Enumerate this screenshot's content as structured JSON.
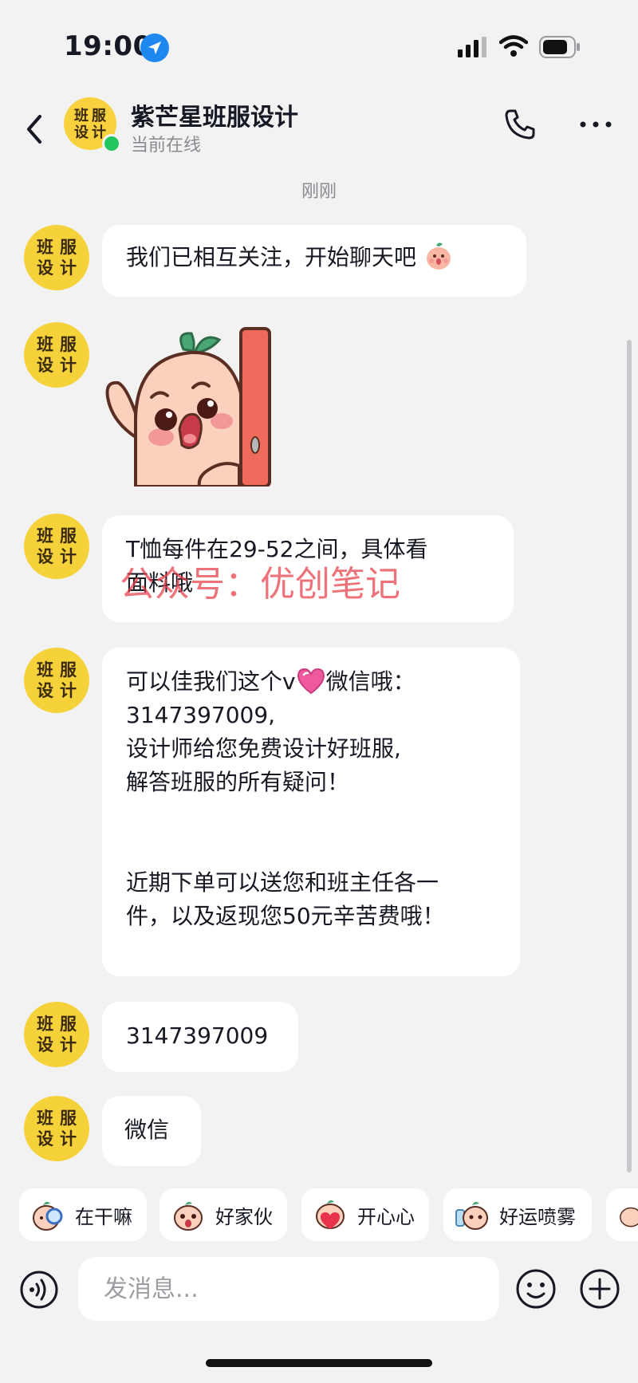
{
  "status_bar": {
    "time": "19:00"
  },
  "header": {
    "contact_name": "紫芒星班服设计",
    "contact_status": "当前在线",
    "avatar_text": [
      "班",
      "服",
      "设",
      "计"
    ]
  },
  "chat": {
    "timestamp": "刚刚",
    "messages": [
      {
        "type": "text",
        "text": "我们已相互关注，开始聊天吧"
      },
      {
        "type": "sticker",
        "icon": "peach-peek-sticker"
      },
      {
        "type": "text",
        "lines": [
          "T恤每件在29-52之间，具体看",
          "面料哦"
        ]
      },
      {
        "type": "text",
        "lines": [
          "可以佳我们这个v",
          "微信哦：",
          "3147397009,",
          "设计师给您免费设计好班服,",
          "解答班服的所有疑问！",
          "",
          "",
          "近期下单可以送您和班主任各一",
          "件，以及返现您50元辛苦费哦！"
        ]
      },
      {
        "type": "text",
        "text": "3147397009"
      },
      {
        "type": "text",
        "text": "微信"
      }
    ],
    "watermark": "公众号：优创笔记"
  },
  "quick_replies": [
    "在干嘛",
    "好家伙",
    "开心心",
    "好运喷雾"
  ],
  "input": {
    "placeholder": "发消息..."
  },
  "colors": {
    "background": "#f2f2f2",
    "bubble": "#ffffff",
    "avatar": "#f5d23a",
    "online": "#22c55e",
    "watermark": "#e83c46"
  },
  "icons": {
    "back": "chevron-left-icon",
    "phone": "phone-icon",
    "more": "more-dots-icon",
    "voice": "voice-icon",
    "emoji": "emoji-icon",
    "plus": "plus-icon"
  }
}
